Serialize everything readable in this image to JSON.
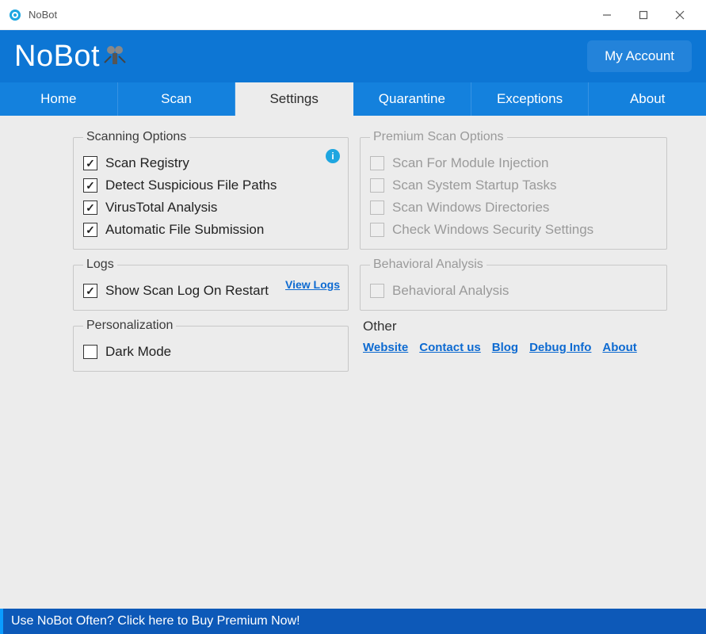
{
  "titlebar": {
    "title": "NoBot"
  },
  "banner": {
    "logo": "NoBot",
    "my_account": "My Account"
  },
  "tabs": [
    {
      "label": "Home",
      "active": false
    },
    {
      "label": "Scan",
      "active": false
    },
    {
      "label": "Settings",
      "active": true
    },
    {
      "label": "Quarantine",
      "active": false
    },
    {
      "label": "Exceptions",
      "active": false
    },
    {
      "label": "About",
      "active": false
    }
  ],
  "groups": {
    "scanning": {
      "legend": "Scanning Options",
      "items": [
        {
          "label": "Scan Registry",
          "checked": true
        },
        {
          "label": "Detect Suspicious File Paths",
          "checked": true
        },
        {
          "label": "VirusTotal Analysis",
          "checked": true
        },
        {
          "label": "Automatic File Submission",
          "checked": true
        }
      ]
    },
    "logs": {
      "legend": "Logs",
      "view_logs": "View Logs",
      "items": [
        {
          "label": "Show Scan Log On Restart",
          "checked": true
        }
      ]
    },
    "personalization": {
      "legend": "Personalization",
      "items": [
        {
          "label": "Dark Mode",
          "checked": false
        }
      ]
    },
    "premium": {
      "legend": "Premium Scan Options",
      "items": [
        {
          "label": "Scan For Module Injection",
          "checked": false
        },
        {
          "label": "Scan System Startup Tasks",
          "checked": false
        },
        {
          "label": "Scan Windows Directories",
          "checked": false
        },
        {
          "label": "Check Windows Security Settings",
          "checked": false
        }
      ]
    },
    "behavioral": {
      "legend": "Behavioral Analysis",
      "items": [
        {
          "label": "Behavioral Analysis",
          "checked": false
        }
      ]
    }
  },
  "other": {
    "title": "Other",
    "links": [
      "Website",
      "Contact us",
      "Blog",
      "Debug Info",
      "About"
    ]
  },
  "footer": {
    "text": "Use NoBot Often? Click here to Buy Premium Now!"
  }
}
